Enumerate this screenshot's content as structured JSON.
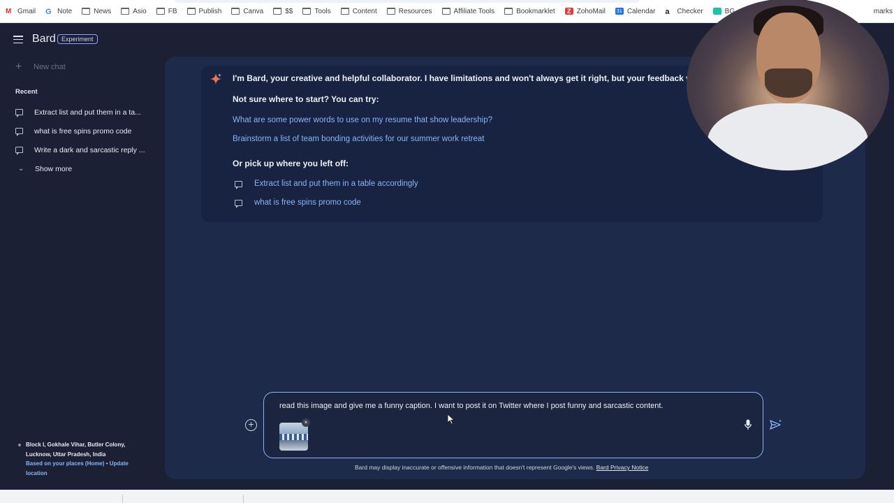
{
  "bookmarks": [
    {
      "label": "Gmail",
      "icon": "gmail-icon"
    },
    {
      "label": "Note",
      "icon": "google-icon"
    },
    {
      "label": "News",
      "icon": "folder-icon"
    },
    {
      "label": "Asio",
      "icon": "folder-icon"
    },
    {
      "label": "FB",
      "icon": "folder-icon"
    },
    {
      "label": "Publish",
      "icon": "folder-icon"
    },
    {
      "label": "Canva",
      "icon": "folder-icon"
    },
    {
      "label": "$$",
      "icon": "folder-icon"
    },
    {
      "label": "Tools",
      "icon": "folder-icon"
    },
    {
      "label": "Content",
      "icon": "folder-icon"
    },
    {
      "label": "Resources",
      "icon": "folder-icon"
    },
    {
      "label": "Affiliate Tools",
      "icon": "folder-icon"
    },
    {
      "label": "Bookmarklet",
      "icon": "folder-icon"
    },
    {
      "label": "ZohoMail",
      "icon": "zoho-icon"
    },
    {
      "label": "Calendar",
      "icon": "calendar-icon"
    },
    {
      "label": "Checker",
      "icon": "amazon-icon"
    },
    {
      "label": "BG",
      "icon": "bg-icon"
    }
  ],
  "bookmarks_overflow": "marks",
  "app": {
    "name": "Bard",
    "badge": "Experiment"
  },
  "sidebar": {
    "new_chat": "New chat",
    "recent_label": "Recent",
    "recent_items": [
      "Extract list and put them in a ta...",
      "what is free spins promo code",
      "Write a dark and sarcastic reply ..."
    ],
    "show_more": "Show more",
    "location": {
      "line1": "Block I, Gokhale Vihar, Butler Colony,",
      "line2": "Lucknow, Uttar Pradesh, India",
      "link1": "Based on your places (Home)",
      "sep": " • ",
      "link2": "Update",
      "link3": "location"
    }
  },
  "welcome": {
    "intro": "I'm Bard, your creative and helpful collaborator. I have limitations and won't always get it right, but your feedback wil",
    "try_label": "Not sure where to start? You can try:",
    "prompts": [
      "What are some power words to use on my resume that show leadership?",
      "Brainstorm a list of team bonding activities for our summer work retreat"
    ],
    "pickup_label": "Or pick up where you left off:",
    "previous": [
      "Extract list and put them in a table accordingly",
      "what is free spins promo code"
    ]
  },
  "input": {
    "value": "read this image and give me a funny caption. I want to post it on Twitter where I post funny and sarcastic content.",
    "attachment_close": "×"
  },
  "footer": {
    "disclaimer": "Bard may display inaccurate or offensive information that doesn't represent Google's views.",
    "privacy_link": "Bard Privacy Notice"
  },
  "colors": {
    "background": "#1b2035",
    "panel": "#1e2a4a",
    "card": "#172340",
    "link": "#8ab4f8",
    "accent": "#8ea2ff"
  }
}
